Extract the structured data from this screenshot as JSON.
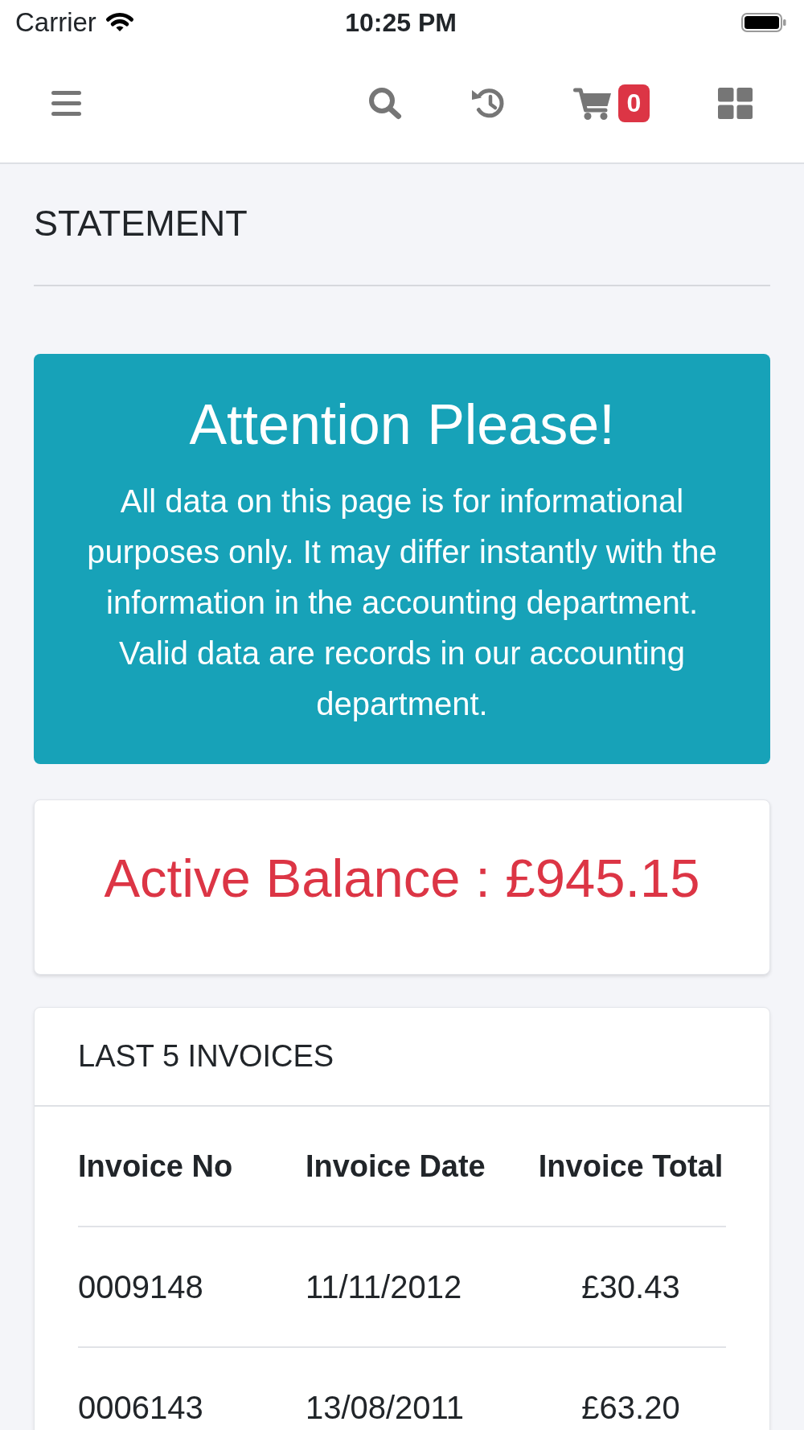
{
  "status_bar": {
    "carrier": "Carrier",
    "time": "10:25 PM"
  },
  "navbar": {
    "cart_count": "0"
  },
  "page_title": "STATEMENT",
  "alert": {
    "title": "Attention Please!",
    "message": "All data on this page is for informational purposes only. It may differ instantly with the information in the accounting department. Valid data are records in our accounting department."
  },
  "balance": {
    "text": "Active Balance : £945.15"
  },
  "invoices": {
    "title": "LAST 5 INVOICES",
    "columns": [
      "Invoice No",
      "Invoice Date",
      "Invoice Total"
    ],
    "rows": [
      [
        "0009148",
        "11/11/2012",
        "£30.43"
      ],
      [
        "0006143",
        "13/08/2011",
        "£63.20"
      ]
    ]
  }
}
